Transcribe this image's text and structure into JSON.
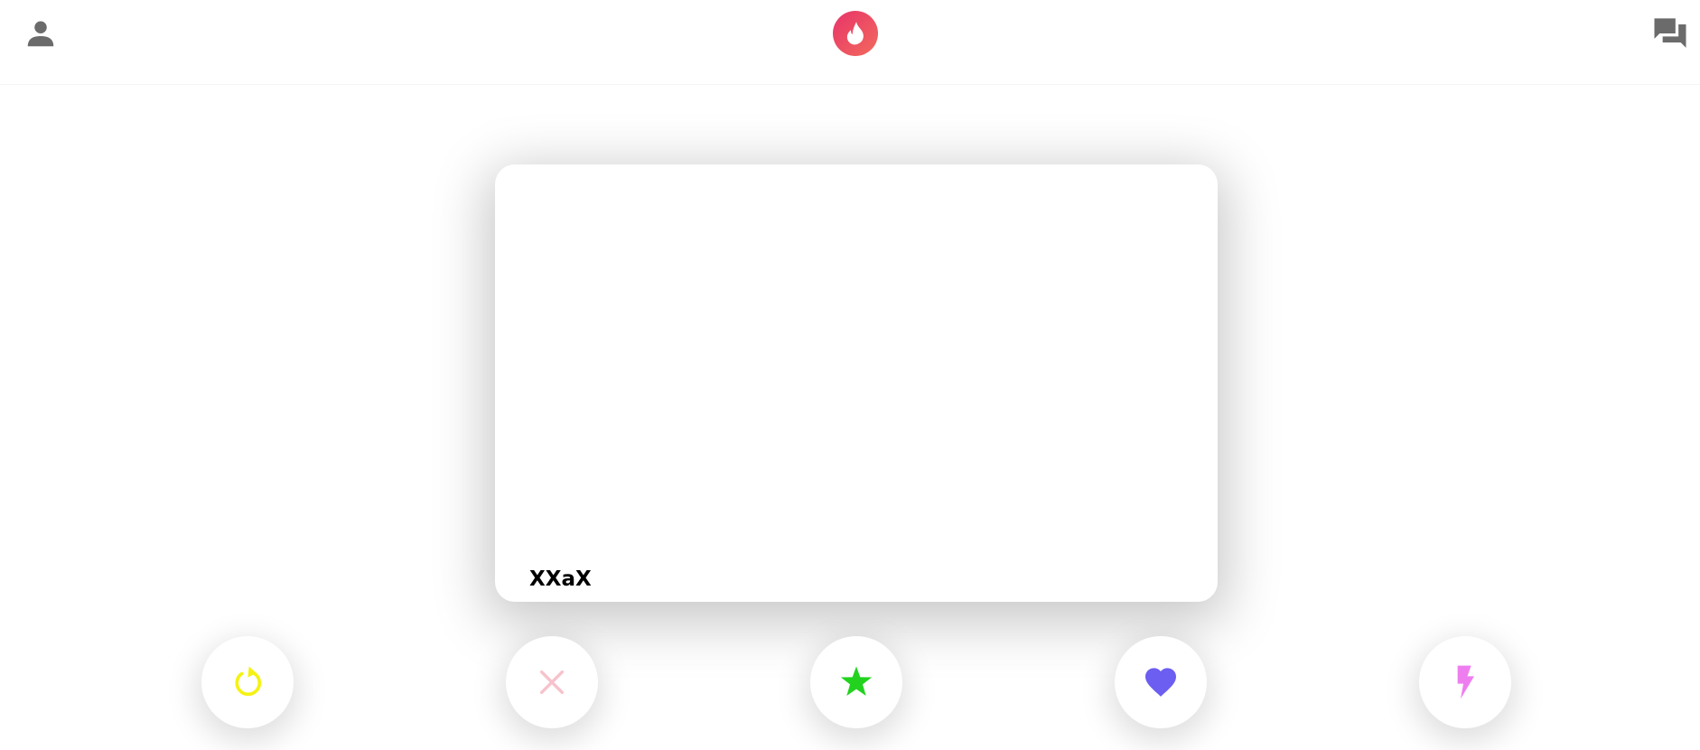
{
  "header": {
    "profile_icon": "person-icon",
    "logo_icon": "flame-icon",
    "chat_icon": "chat-bubbles-icon"
  },
  "card": {
    "name": "XXaX"
  },
  "actions": [
    {
      "id": "undo",
      "icon": "undo-icon",
      "color": "#f5f212"
    },
    {
      "id": "nope",
      "icon": "close-icon",
      "color": "#f7c2cb"
    },
    {
      "id": "super-like",
      "icon": "star-icon",
      "color": "#22d21f"
    },
    {
      "id": "like",
      "icon": "heart-icon",
      "color": "#6b5ef0"
    },
    {
      "id": "boost",
      "icon": "bolt-icon",
      "color": "#ee7ef0"
    }
  ],
  "colors": {
    "brand_gradient_start": "#e8336a",
    "brand_gradient_end": "#f26a5c",
    "header_icon": "#6b6b6b"
  }
}
